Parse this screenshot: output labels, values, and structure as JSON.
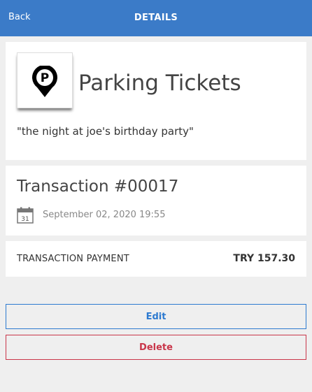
{
  "header": {
    "back_label": "Back",
    "title": "DETAILS"
  },
  "category": {
    "icon": "parking-pin-icon",
    "icon_letter": "P",
    "name": "Parking Tickets",
    "note": "\"the night at joe's birthday party\""
  },
  "transaction": {
    "title": "Transaction #00017",
    "calendar_day": "31",
    "date": "September 02, 2020 19:55"
  },
  "payment": {
    "label": "TRANSACTION PAYMENT",
    "amount": "TRY 157.30"
  },
  "actions": {
    "edit_label": "Edit",
    "delete_label": "Delete"
  },
  "colors": {
    "header_bg": "#3b7bc8",
    "edit_accent": "#2d7ad0",
    "delete_accent": "#c9364a",
    "page_bg": "#efefef"
  }
}
